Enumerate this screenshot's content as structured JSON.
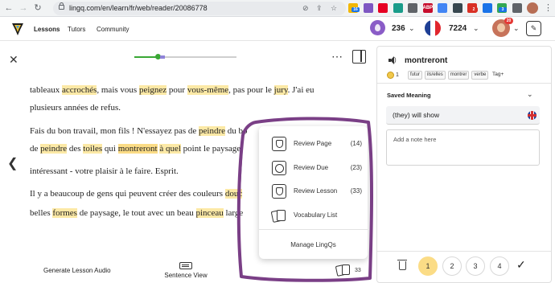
{
  "browser": {
    "url": "lingq.com/en/learn/fr/web/reader/20086778",
    "extensions": [
      {
        "icon": "extension-yellow-icon",
        "label": "",
        "color": "#f2b705"
      },
      {
        "icon": "extension-purple-icon",
        "label": "",
        "color": "#7e57c2"
      },
      {
        "icon": "pinterest-icon",
        "label": "",
        "color": "#e60023"
      },
      {
        "icon": "extension-teal-icon",
        "label": "",
        "color": "#1a9c8a"
      },
      {
        "icon": "extension-grey-icon",
        "label": "",
        "color": "#5f6368"
      },
      {
        "icon": "abp-icon",
        "label": "ABP",
        "color": "#c70d2c"
      },
      {
        "icon": "chrome-icon",
        "label": "",
        "color": "#4285f4"
      },
      {
        "icon": "extension-dark-icon",
        "label": "",
        "color": "#37474f"
      },
      {
        "icon": "extension-red-icon",
        "label": "",
        "color": "#d93025"
      },
      {
        "icon": "extension-blue-icon",
        "label": "",
        "color": "#1a73e8"
      },
      {
        "icon": "extension-green-icon",
        "label": "",
        "color": "#34a853"
      },
      {
        "icon": "puzzle-icon",
        "label": "",
        "color": "#5f6368"
      }
    ],
    "extension_badges": {
      "first": "16",
      "second": "2",
      "third": "3"
    }
  },
  "header": {
    "nav": [
      "Lessons",
      "Tutors",
      "Community"
    ],
    "streak_count": "236",
    "language_count": "7224",
    "notification_count": "20"
  },
  "reader": {
    "paragraphs": [
      [
        {
          "t": "tableaux "
        },
        {
          "t": "accrochés",
          "h": "yellow"
        },
        {
          "t": ", mais vous "
        },
        {
          "t": "peignez",
          "h": "yellow"
        },
        {
          "t": " pour "
        },
        {
          "t": "vous-même",
          "h": "yellow"
        },
        {
          "t": ", pas pour le "
        },
        {
          "t": "jury",
          "h": "yellow"
        },
        {
          "t": ".  J'ai eu"
        }
      ],
      [
        {
          "t": "plusieurs années de refus."
        }
      ],
      [
        {
          "t": "Fais du bon travail, mon fils !  N'essayez pas de "
        },
        {
          "t": "peindre",
          "h": "yellow"
        },
        {
          "t": " du bo"
        }
      ],
      [
        {
          "t": "de "
        },
        {
          "t": "peindre",
          "h": "yellow"
        },
        {
          "t": " des "
        },
        {
          "t": "toiles",
          "h": "yellow"
        },
        {
          "t": " qui "
        },
        {
          "t": "montreront",
          "h": "strong"
        },
        {
          "t": " "
        },
        {
          "t": "à quel",
          "h": "yellow"
        },
        {
          "t": " point le paysage"
        }
      ],
      [
        {
          "t": "intéressant - votre plaisir à le faire.  Esprit."
        }
      ],
      [
        {
          "t": "Il y a beaucoup de gens qui peuvent créer des couleurs "
        },
        {
          "t": "douc",
          "h": "yellow"
        }
      ],
      [
        {
          "t": "belles "
        },
        {
          "t": "formes",
          "h": "yellow"
        },
        {
          "t": " de paysage, le tout avec un beau "
        },
        {
          "t": "pinceau",
          "h": "yellow"
        },
        {
          "t": " large"
        }
      ]
    ],
    "progress_percent": 26
  },
  "bottom": {
    "generate_audio": "Generate Lesson Audio",
    "sentence_view": "Sentence View",
    "lingq_count": "33"
  },
  "popup": {
    "items": [
      {
        "label": "Review Page",
        "count": "(14)",
        "icon": "review-page-icon"
      },
      {
        "label": "Review Due",
        "count": "(23)",
        "icon": "clock-icon"
      },
      {
        "label": "Review Lesson",
        "count": "(33)",
        "icon": "review-lesson-icon"
      },
      {
        "label": "Vocabulary List",
        "count": "",
        "icon": "vocabulary-cards-icon"
      }
    ],
    "manage": "Manage LingQs"
  },
  "panel": {
    "word": "montreront",
    "coins": "1",
    "tags": [
      "futur",
      "ils/elles",
      "montrer",
      "verbe"
    ],
    "tag_add": "Tag+",
    "saved_meaning_title": "Saved Meaning",
    "meaning": "(they) will show",
    "note_placeholder": "Add a note here",
    "statuses": [
      "1",
      "2",
      "3",
      "4"
    ],
    "active_status": "1"
  },
  "colors": {
    "highlight_yellow": "#fce9a6",
    "highlight_strong": "#fbdc86",
    "annotation_purple": "#7a3f86",
    "progress_green": "#3aa835",
    "streak_purple": "#8a5cc7"
  }
}
